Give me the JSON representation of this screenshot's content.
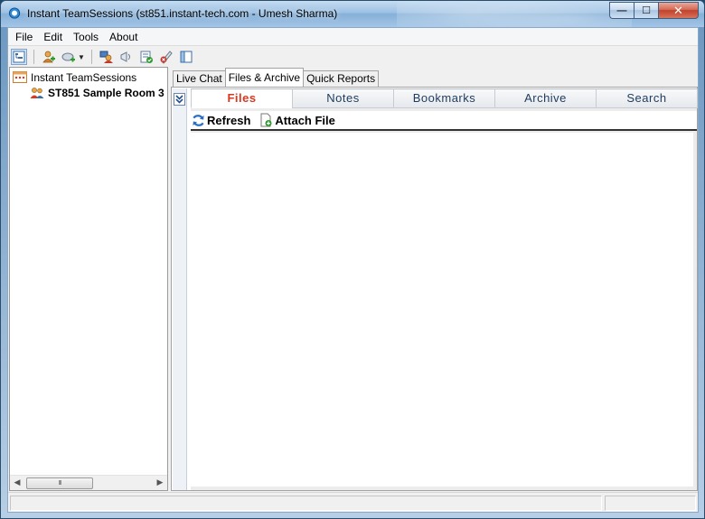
{
  "window": {
    "title": "Instant TeamSessions (st851.instant-tech.com - Umesh Sharma)",
    "min_glyph": "—",
    "max_glyph": "☐",
    "close_glyph": "✕"
  },
  "menubar": {
    "items": [
      "File",
      "Edit",
      "Tools",
      "About"
    ]
  },
  "toolbar": {
    "icons": [
      "tree-view-icon",
      "add-user-icon",
      "add-room-icon",
      "dropdown-arrow-icon",
      "user-settings-icon",
      "broadcast-icon",
      "checklist-icon",
      "remove-user-icon",
      "panel-layout-icon"
    ]
  },
  "tree": {
    "root_label": "Instant TeamSessions",
    "child_label": "ST851 Sample Room 3"
  },
  "left_scroll": {
    "thumb_grip": "III"
  },
  "main_tabs": [
    "Live Chat",
    "Files & Archive",
    "Quick Reports"
  ],
  "active_main_tab": "Files & Archive",
  "sub_tabs": [
    "Files",
    "Notes",
    "Bookmarks",
    "Archive",
    "Search"
  ],
  "active_sub_tab": "Files",
  "files_toolbar": {
    "refresh_label": "Refresh",
    "attach_label": "Attach File"
  },
  "status": {
    "left": "",
    "right": ""
  },
  "colors": {
    "active_subtab_text": "#d9381e",
    "subtab_text": "#1d3b5f",
    "title_gradient": "#9cc0e3"
  }
}
